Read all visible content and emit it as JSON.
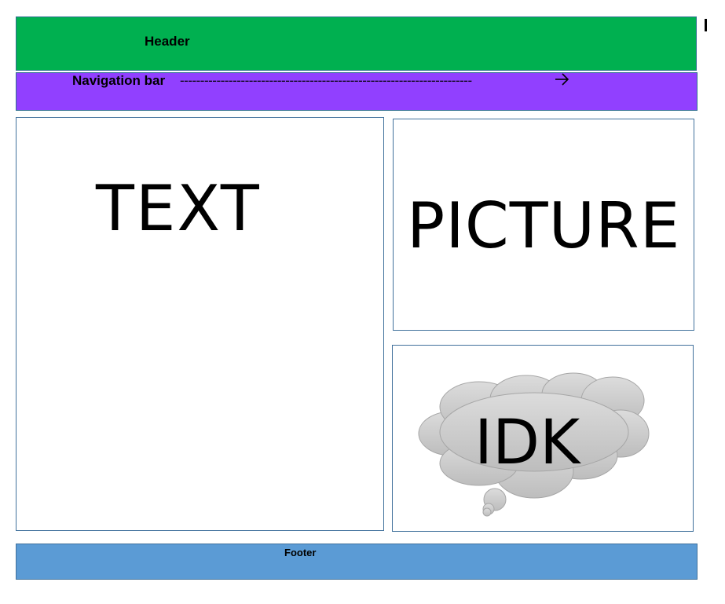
{
  "header": {
    "label": "Header"
  },
  "nav": {
    "label": "Navigation bar",
    "dashes": "------------------------------------------------------------------------",
    "arrow_icon": "right-arrow-icon"
  },
  "text_panel": {
    "label": "TEXT"
  },
  "picture_panel": {
    "label": "PICTURE"
  },
  "idk_panel": {
    "label": "IDK",
    "shape_icon": "thought-bubble-icon"
  },
  "footer": {
    "label": "Footer"
  },
  "colors": {
    "header": "#00b050",
    "nav": "#9140ff",
    "footer": "#5b9bd5",
    "panel_border": "#41719c",
    "cloud_fill": "#cccccc"
  }
}
